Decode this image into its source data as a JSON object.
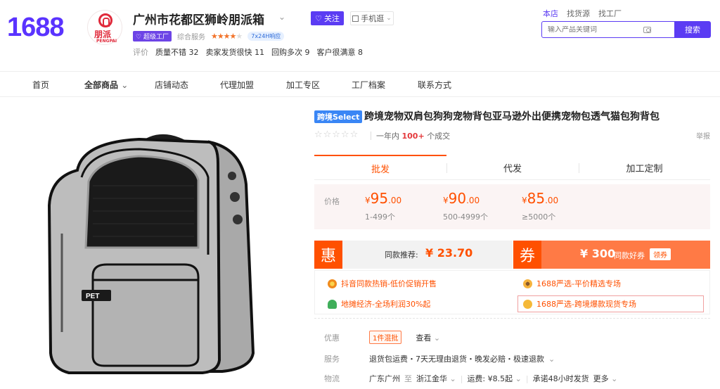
{
  "header": {
    "logo": "1688",
    "shop_logo_cn": "朋派",
    "shop_logo_en": "PENGPAI",
    "shop_name": "广州市花都区狮岭朋派箱",
    "follow_label": "关注",
    "mobile_label": "手机逛",
    "super_factory": "超级工厂",
    "service_label": "综合服务",
    "badge_24h": "7x24H响应",
    "rating_label": "评价",
    "ratings": [
      "质量不错 32",
      "卖家发货很快 11",
      "回购多次 9",
      "客户很满意 8"
    ],
    "scope_tabs": [
      "本店",
      "找货源",
      "找工厂"
    ],
    "search_placeholder": "输入产品关键词",
    "search_button": "搜索"
  },
  "nav": {
    "items": [
      "首页",
      "全部商品",
      "店铺动态",
      "代理加盟",
      "加工专区",
      "工厂档案",
      "联系方式"
    ]
  },
  "product": {
    "badge": "跨境Select",
    "title": "跨境宠物双肩包狗狗宠物背包亚马逊外出便携宠物包透气猫包狗背包",
    "sales_prefix": "一年内",
    "sales_count": "100+",
    "sales_suffix": "个成交",
    "report": "举报",
    "pet_label": "PET",
    "mode_tabs": [
      "批发",
      "代发",
      "加工定制"
    ],
    "price_label": "价格",
    "prices": [
      {
        "int": "95",
        "dec": ".00",
        "range": "1-499个"
      },
      {
        "int": "90",
        "dec": ".00",
        "range": "500-4999个"
      },
      {
        "int": "85",
        "dec": ".00",
        "range": "≥5000个"
      }
    ],
    "currency": "¥",
    "hui_mark": "惠",
    "hui_text": "同款推荐:",
    "hui_value": "¥ 23.70",
    "quan_mark": "券",
    "quan_value": "¥ 300",
    "quan_text": "同款好券",
    "quan_button": "领券",
    "promos": [
      "抖音同款热销-低价促销开售",
      "1688严选-平价精选专场",
      "地摊经济-全场利润30%起",
      "1688严选-跨境爆款现货专场"
    ],
    "discount_label": "优惠",
    "discount_chip": "1件混批",
    "discount_view": "查看",
    "service_label": "服务",
    "service_text": "退货包运费・7天无理由退货・晚发必赔・极速退款",
    "logistics_label": "物流",
    "logistics_from": "广东广州",
    "logistics_to_word": "至",
    "logistics_to": "浙江金华",
    "logistics_fee": "运费: ¥8.5起",
    "logistics_promise": "承诺48小时发货",
    "logistics_more": "更多"
  },
  "colors": {
    "brand": "#5b3cf3",
    "price": "#ff5000"
  }
}
